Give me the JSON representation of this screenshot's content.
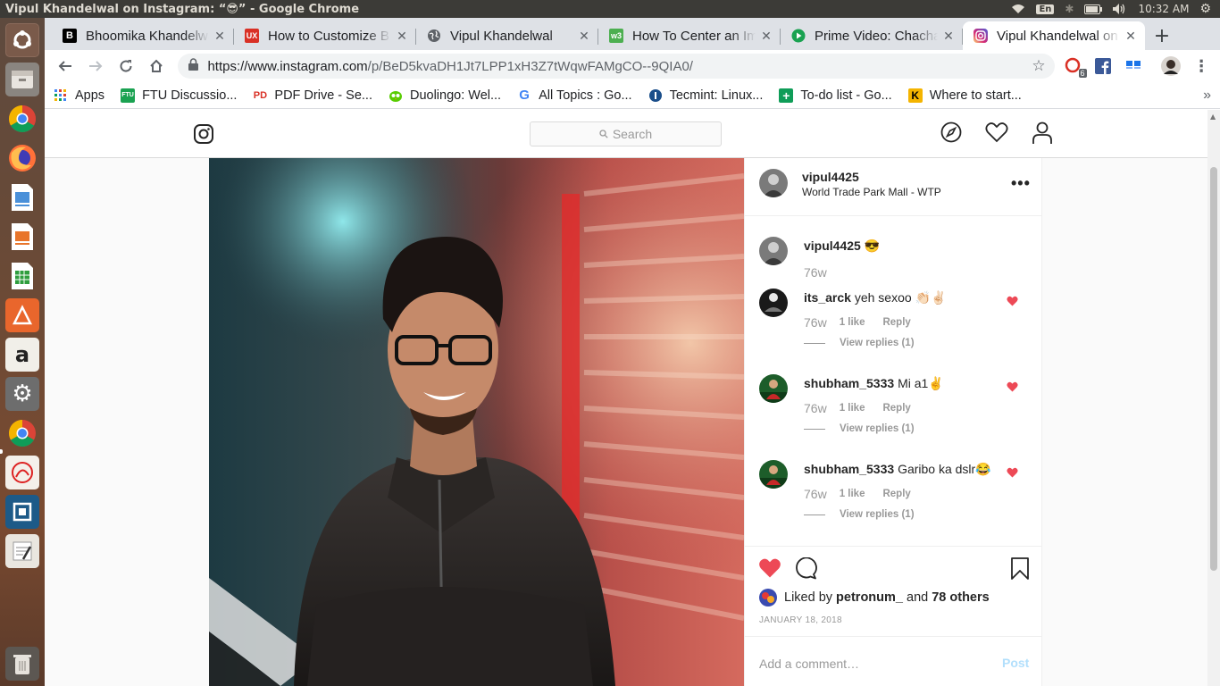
{
  "system": {
    "window_title": "Vipul Khandelwal on Instagram: “😎” - Google Chrome",
    "keyboard_layout": "En",
    "clock": "10:32 AM"
  },
  "launcher": {
    "items": [
      "ubuntu-dash",
      "files",
      "chrome",
      "firefox",
      "writer",
      "impress",
      "calc",
      "software-center",
      "amazon",
      "settings",
      "chrome",
      "pdf-viewer",
      "virtualbox",
      "text-editor",
      "trash"
    ]
  },
  "tabs": [
    {
      "title": "Bhoomika Khandelwal",
      "favicon": "B",
      "color": "#000000"
    },
    {
      "title": "How to Customize B",
      "favicon": "UX",
      "color": "#d93025"
    },
    {
      "title": "Vipul Khandelwal",
      "favicon": "globe",
      "color": "#5f6368"
    },
    {
      "title": "How To Center an Im",
      "favicon": "W3",
      "color": "#4caf50"
    },
    {
      "title": "Prime Video: Chacha",
      "favicon": "play",
      "color": "#1aa251"
    },
    {
      "title": "Vipul Khandelwal on",
      "favicon": "instagram",
      "color": "#c13584"
    }
  ],
  "toolbar": {
    "url_host": "https://www.instagram.com",
    "url_path": "/p/BeD5kvaDH1Jt7LPP1xH3Z7tWqwFAMgCO--9QIA0/",
    "ext_badge": "6"
  },
  "bookmarks": [
    {
      "label": "Apps",
      "icon": "apps-grid",
      "color": "#4285f4"
    },
    {
      "label": "FTU Discussio...",
      "icon": "FTU",
      "color": "#1aa251"
    },
    {
      "label": "PDF Drive - Se...",
      "icon": "PD",
      "color": "#d93025"
    },
    {
      "label": "Duolingo: Wel...",
      "icon": "owl",
      "color": "#58cc02"
    },
    {
      "label": "All Topics : Go...",
      "icon": "G",
      "color": "#4285f4"
    },
    {
      "label": "Tecmint: Linux...",
      "icon": "tecmint",
      "color": "#1a73e8"
    },
    {
      "label": "To-do list - Go...",
      "icon": "plus",
      "color": "#0f9d58"
    },
    {
      "label": "Where to start...",
      "icon": "K",
      "color": "#f4b400"
    }
  ],
  "instagram": {
    "search_placeholder": "Search",
    "post": {
      "owner": "vipul4425",
      "location": "World Trade Park Mall - WTP",
      "caption_user": "vipul4425",
      "caption_text": "😎",
      "caption_age": "76w",
      "comments": [
        {
          "user": "its_arck",
          "text": "yeh sexoo 👏🏻✌🏻",
          "age": "76w",
          "likes": "1 like",
          "reply": "Reply",
          "view_replies": "View replies (1)"
        },
        {
          "user": "shubham_5333",
          "text": "Mi a1✌",
          "age": "76w",
          "likes": "1 like",
          "reply": "Reply",
          "view_replies": "View replies (1)"
        },
        {
          "user": "shubham_5333",
          "text": "Garibo ka dslr😂",
          "age": "76w",
          "likes": "1 like",
          "reply": "Reply",
          "view_replies": "View replies (1)"
        }
      ],
      "liked_by_prefix": "Liked by",
      "liked_by_user": "petronum_",
      "liked_by_and": "and",
      "liked_by_others": "78 others",
      "date": "JANUARY 18, 2018",
      "add_comment_placeholder": "Add a comment…",
      "post_button": "Post"
    }
  }
}
